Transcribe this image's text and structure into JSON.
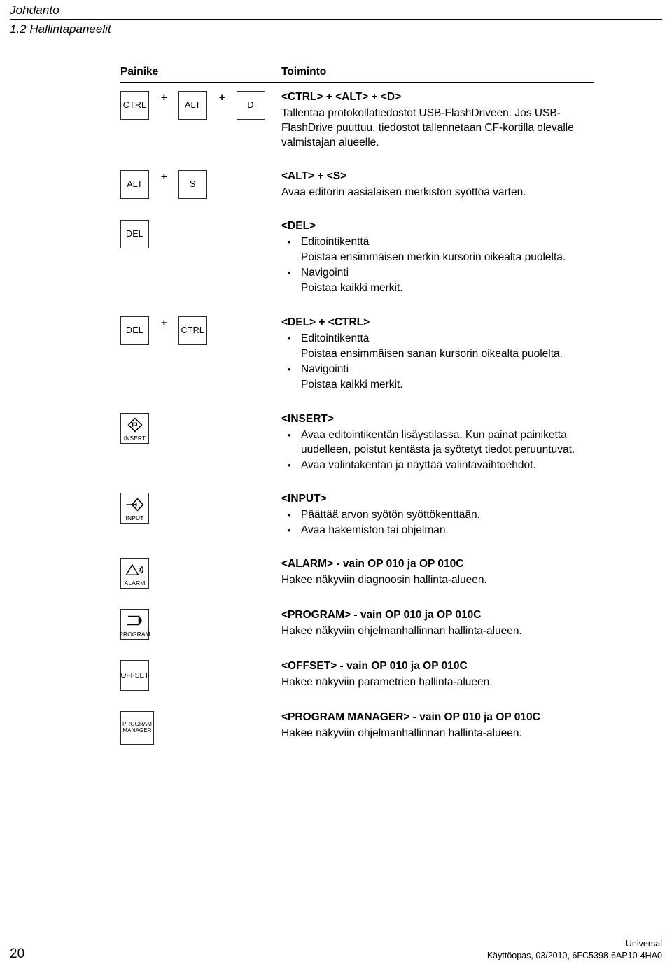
{
  "header": {
    "chapter": "Johdanto",
    "section": "1.2 Hallintapaneelit"
  },
  "table": {
    "columns": {
      "keys": "Painike",
      "function": "Toiminto"
    },
    "rows": [
      {
        "keys": [
          {
            "type": "text",
            "label": "CTRL"
          },
          {
            "type": "plus",
            "label": "+"
          },
          {
            "type": "text",
            "label": "ALT"
          },
          {
            "type": "plus",
            "label": "+"
          },
          {
            "type": "text",
            "label": "D"
          }
        ],
        "title": "<CTRL> + <ALT> + <D>",
        "paragraph": "Tallentaa protokollatiedostot USB-FlashDriveen. Jos USB-FlashDrive puuttuu, tiedostot tallennetaan CF-kortilla olevalle valmistajan alueelle.",
        "bullets": []
      },
      {
        "keys": [
          {
            "type": "text",
            "label": "ALT"
          },
          {
            "type": "plus",
            "label": "+"
          },
          {
            "type": "text",
            "label": "S"
          }
        ],
        "title": "<ALT> + <S>",
        "paragraph": "Avaa editorin aasialaisen merkistön syöttöä varten.",
        "bullets": []
      },
      {
        "keys": [
          {
            "type": "text",
            "label": "DEL"
          }
        ],
        "title": "<DEL>",
        "paragraph": "",
        "bullets": [
          {
            "label": "Editointikenttä",
            "sub": "Poistaa ensimmäisen merkin kursorin oikealta puolelta."
          },
          {
            "label": "Navigointi",
            "sub": "Poistaa kaikki merkit."
          }
        ]
      },
      {
        "keys": [
          {
            "type": "text",
            "label": "DEL"
          },
          {
            "type": "plus",
            "label": "+"
          },
          {
            "type": "text",
            "label": "CTRL"
          }
        ],
        "title": "<DEL> + <CTRL>",
        "paragraph": "",
        "bullets": [
          {
            "label": "Editointikenttä",
            "sub": "Poistaa ensimmäisen sanan kursorin oikealta puolelta."
          },
          {
            "label": "Navigointi",
            "sub": "Poistaa kaikki merkit."
          }
        ]
      },
      {
        "keys": [
          {
            "type": "icon",
            "icon": "insert-diamond-icon",
            "label": "INSERT"
          }
        ],
        "title": "<INSERT>",
        "paragraph": "",
        "bullets": [
          {
            "label": "Avaa editointikentän lisäystilassa. Kun painat painiketta uudelleen, poistut kentästä ja syötetyt tiedot peruuntuvat.",
            "sub": ""
          },
          {
            "label": "Avaa valintakentän ja näyttää valintavaihtoehdot.",
            "sub": ""
          }
        ]
      },
      {
        "keys": [
          {
            "type": "icon",
            "icon": "input-arrow-diamond-icon",
            "label": "INPUT"
          }
        ],
        "title": "<INPUT>",
        "paragraph": "",
        "bullets": [
          {
            "label": "Päättää arvon syötön syöttökenttään.",
            "sub": ""
          },
          {
            "label": "Avaa hakemiston tai ohjelman.",
            "sub": ""
          }
        ]
      },
      {
        "keys": [
          {
            "type": "icon",
            "icon": "alarm-triangle-icon",
            "label": "ALARM"
          }
        ],
        "title": "<ALARM> - vain OP 010 ja OP 010C",
        "paragraph": "Hakee näkyviin diagnoosin hallinta-alueen.",
        "bullets": []
      },
      {
        "keys": [
          {
            "type": "icon",
            "icon": "program-bracket-icon",
            "label": "PROGRAM"
          }
        ],
        "title": "<PROGRAM> - vain OP 010 ja OP 010C",
        "paragraph": "Hakee näkyviin ohjelmanhallinnan hallinta-alueen.",
        "bullets": []
      },
      {
        "keys": [
          {
            "type": "icon",
            "icon": "offset-text-icon",
            "label": "OFFSET"
          }
        ],
        "title": "<OFFSET> - vain OP 010 ja OP 010C",
        "paragraph": "Hakee näkyviin parametrien hallinta-alueen.",
        "bullets": []
      },
      {
        "keys": [
          {
            "type": "icon",
            "icon": "program-manager-text-icon",
            "label": "PROGRAM\nMANAGER"
          }
        ],
        "title": "<PROGRAM MANAGER> - vain OP 010 ja OP 010C",
        "paragraph": "Hakee näkyviin ohjelmanhallinnan hallinta-alueen.",
        "bullets": []
      }
    ]
  },
  "footer": {
    "page_number": "20",
    "variant": "Universal",
    "manual": "Käyttöopas, 03/2010, 6FC5398-6AP10-4HA0"
  }
}
